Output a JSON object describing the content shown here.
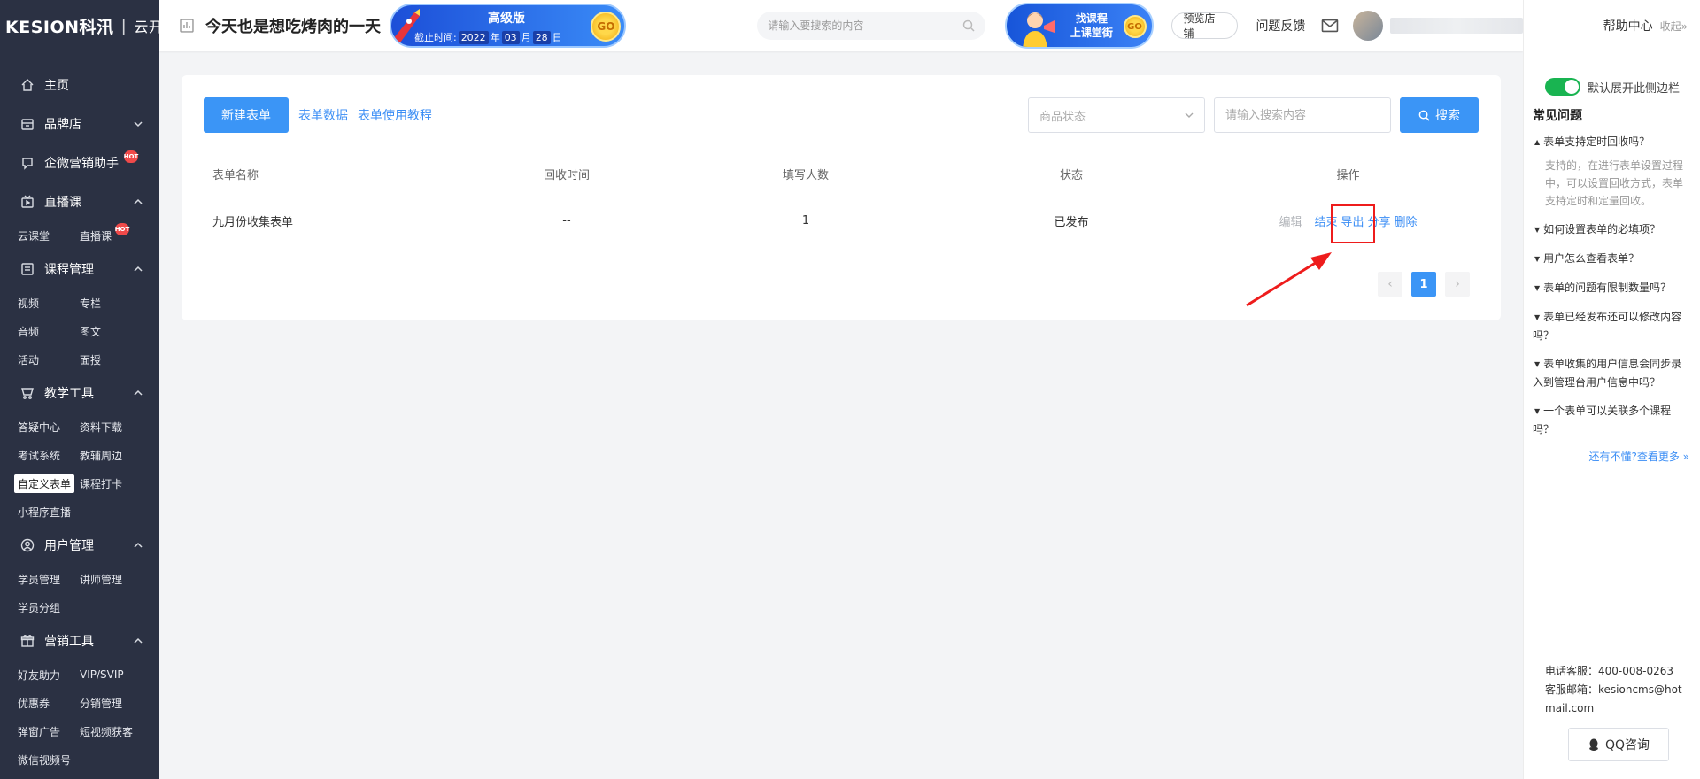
{
  "brand": {
    "logo": "KESION科汛",
    "sub": "云开店"
  },
  "nav": [
    {
      "id": "home",
      "label": "主页",
      "icon": "home-icon",
      "chevron": "",
      "hot": false
    },
    {
      "id": "brand-shop",
      "label": "品牌店",
      "icon": "shop-icon",
      "chevron": "down",
      "hot": false
    },
    {
      "id": "wecom",
      "label": "企微营销助手",
      "icon": "chat-icon",
      "chevron": "",
      "hot": true
    },
    {
      "id": "live",
      "label": "直播课",
      "icon": "live-icon",
      "chevron": "up",
      "hot": false,
      "sub": [
        {
          "label": "云课堂"
        },
        {
          "label": "直播课",
          "hot": true
        }
      ]
    },
    {
      "id": "course",
      "label": "课程管理",
      "icon": "course-icon",
      "chevron": "up",
      "hot": false,
      "sub": [
        {
          "label": "视频"
        },
        {
          "label": "专栏"
        },
        {
          "label": "音频"
        },
        {
          "label": "图文"
        },
        {
          "label": "活动"
        },
        {
          "label": "面授"
        }
      ]
    },
    {
      "id": "teach",
      "label": "教学工具",
      "icon": "tools-icon",
      "chevron": "up",
      "hot": false,
      "sub": [
        {
          "label": "答疑中心"
        },
        {
          "label": "资料下载"
        },
        {
          "label": "考试系统"
        },
        {
          "label": "教辅周边"
        },
        {
          "label": "自定义表单",
          "active": true
        },
        {
          "label": "课程打卡"
        },
        {
          "label": "小程序直播"
        }
      ]
    },
    {
      "id": "user",
      "label": "用户管理",
      "icon": "user-icon",
      "chevron": "up",
      "hot": false,
      "sub": [
        {
          "label": "学员管理"
        },
        {
          "label": "讲师管理"
        },
        {
          "label": "学员分组"
        }
      ]
    },
    {
      "id": "marketing",
      "label": "营销工具",
      "icon": "gift-icon",
      "chevron": "up",
      "hot": false,
      "sub": [
        {
          "label": "好友助力"
        },
        {
          "label": "VIP/SVIP"
        },
        {
          "label": "优惠券"
        },
        {
          "label": "分销管理"
        },
        {
          "label": "弹窗广告"
        },
        {
          "label": "短视频获客"
        },
        {
          "label": "微信视频号"
        }
      ]
    }
  ],
  "hot_label": "HOT",
  "header": {
    "shop_name": "今天也是想吃烤肉的一天",
    "vip": {
      "title": "高级版",
      "date_label": "截止时间:",
      "year": "2022",
      "year_unit": "年",
      "month": "03",
      "month_unit": "月",
      "day": "28",
      "day_unit": "日",
      "go": "GO"
    },
    "search_placeholder": "请输入要搜索的内容",
    "course_banner": {
      "line1": "找课程",
      "line2": "上课堂街",
      "go": "GO"
    },
    "preview_label": "预览店铺",
    "feedback_label": "问题反馈"
  },
  "toolbar": {
    "new_form": "新建表单",
    "form_data": "表单数据",
    "tutorial": "表单使用教程",
    "status_placeholder": "商品状态",
    "search_placeholder": "请输入搜索内容",
    "search_label": "搜索"
  },
  "table": {
    "headers": [
      "表单名称",
      "回收时间",
      "填写人数",
      "状态",
      "操作"
    ],
    "rows": [
      {
        "name": "九月份收集表单",
        "recycle_time": "--",
        "count": "1",
        "status": "已发布",
        "ops": {
          "edit": "编辑",
          "end": "结束",
          "export": "导出",
          "share": "分享",
          "delete": "删除"
        }
      }
    ]
  },
  "pager": {
    "prev": "‹",
    "current": "1",
    "next": "›"
  },
  "help": {
    "title": "帮助中心",
    "collapse": "收起»",
    "toggle_label": "默认展开此侧边栏",
    "faq_title": "常见问题",
    "faqs": [
      {
        "q": "表单支持定时回收吗？",
        "open": true,
        "a": "支持的，在进行表单设置过程中，可以设置回收方式，表单支持定时和定量回收。"
      },
      {
        "q": "如何设置表单的必填项？",
        "open": false
      },
      {
        "q": "用户怎么查看表单？",
        "open": false
      },
      {
        "q": "表单的问题有限制数量吗？",
        "open": false
      },
      {
        "q": "表单已经发布还可以修改内容吗？",
        "open": false
      },
      {
        "q": "表单收集的用户信息会同步录入到管理台用户信息中吗？",
        "open": false
      },
      {
        "q": "一个表单可以关联多个课程吗？",
        "open": false
      }
    ],
    "more": "还有不懂?查看更多 »",
    "phone": "电话客服：400-008-0263",
    "email": "客服邮箱：kesioncms@hotmail.com",
    "qq": "QQ咨询"
  },
  "colors": {
    "accent": "#3b95f6",
    "sidebar": "#2b3143",
    "highlight": "#ee1c1c",
    "toggle": "#19b451"
  }
}
